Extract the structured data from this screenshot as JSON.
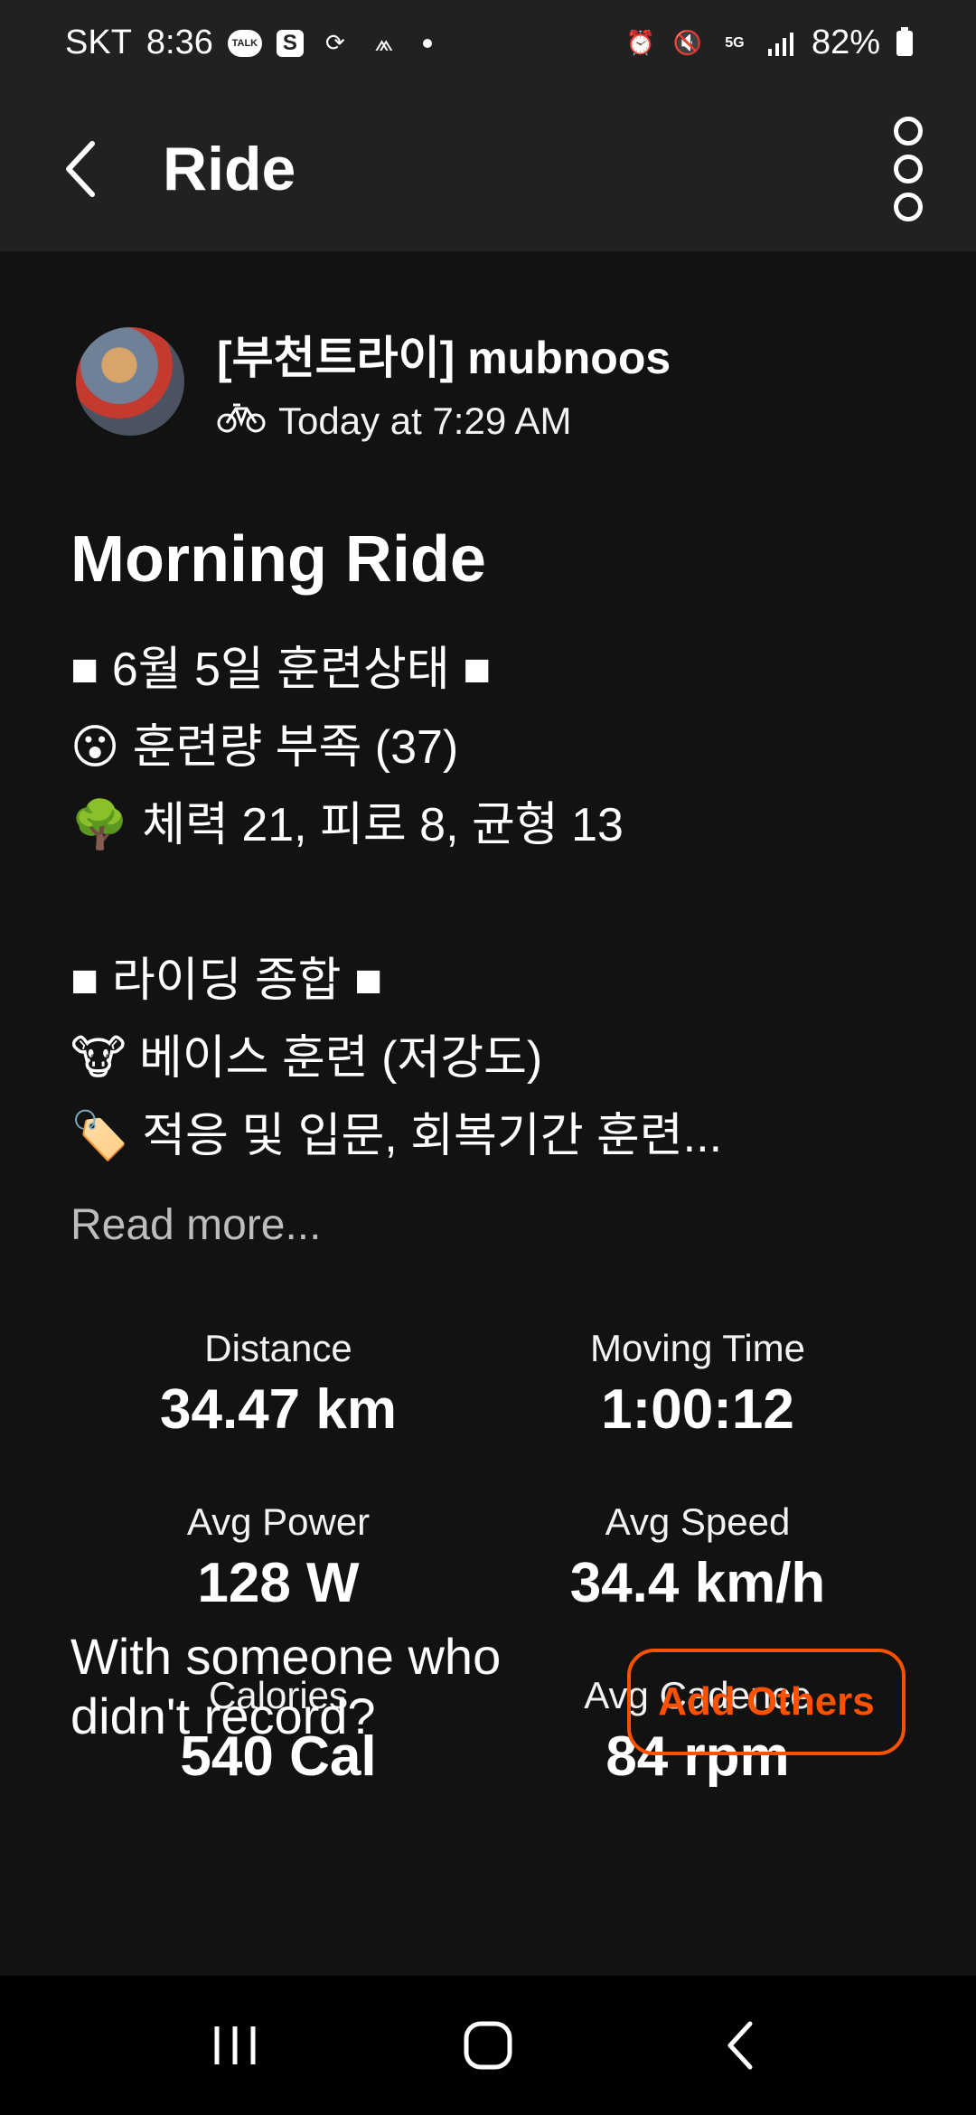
{
  "status_bar": {
    "carrier": "SKT",
    "time": "8:36",
    "bubble_label": "TALK",
    "app_letter": "S",
    "network": "5G",
    "battery": "82%"
  },
  "app_bar": {
    "title": "Ride"
  },
  "athlete": {
    "name": "[부천트라이] mubnoos",
    "date": "Today at 7:29 AM"
  },
  "activity": {
    "title": "Morning Ride",
    "description_lines": [
      "■ 6월 5일 훈련상태 ■",
      "😮 훈련량 부족 (37)",
      "🌳 체력 21, 피로 8, 균형 13",
      "",
      "■ 라이딩 종합 ■",
      "🐮 베이스 훈련 (저강도)",
      "🏷️ 적응 및 입문, 회복기간 훈련..."
    ],
    "read_more": "Read more..."
  },
  "stats": [
    {
      "label": "Distance",
      "value": "34.47 km"
    },
    {
      "label": "Moving Time",
      "value": "1:00:12"
    },
    {
      "label": "Avg Power",
      "value": "128 W"
    },
    {
      "label": "Avg Speed",
      "value": "34.4 km/h"
    },
    {
      "label": "Calories",
      "value": "540 Cal"
    },
    {
      "label": "Avg Cadence",
      "value": "84 rpm"
    }
  ],
  "with_others": {
    "text": "With someone who didn't record?",
    "button": "Add Others"
  },
  "colors": {
    "background": "#121212",
    "bar": "#212121",
    "accent": "#fc5200"
  },
  "icons": {
    "back": "back-arrow-icon",
    "more": "more-vertical-icon",
    "sport": "bike-icon"
  }
}
